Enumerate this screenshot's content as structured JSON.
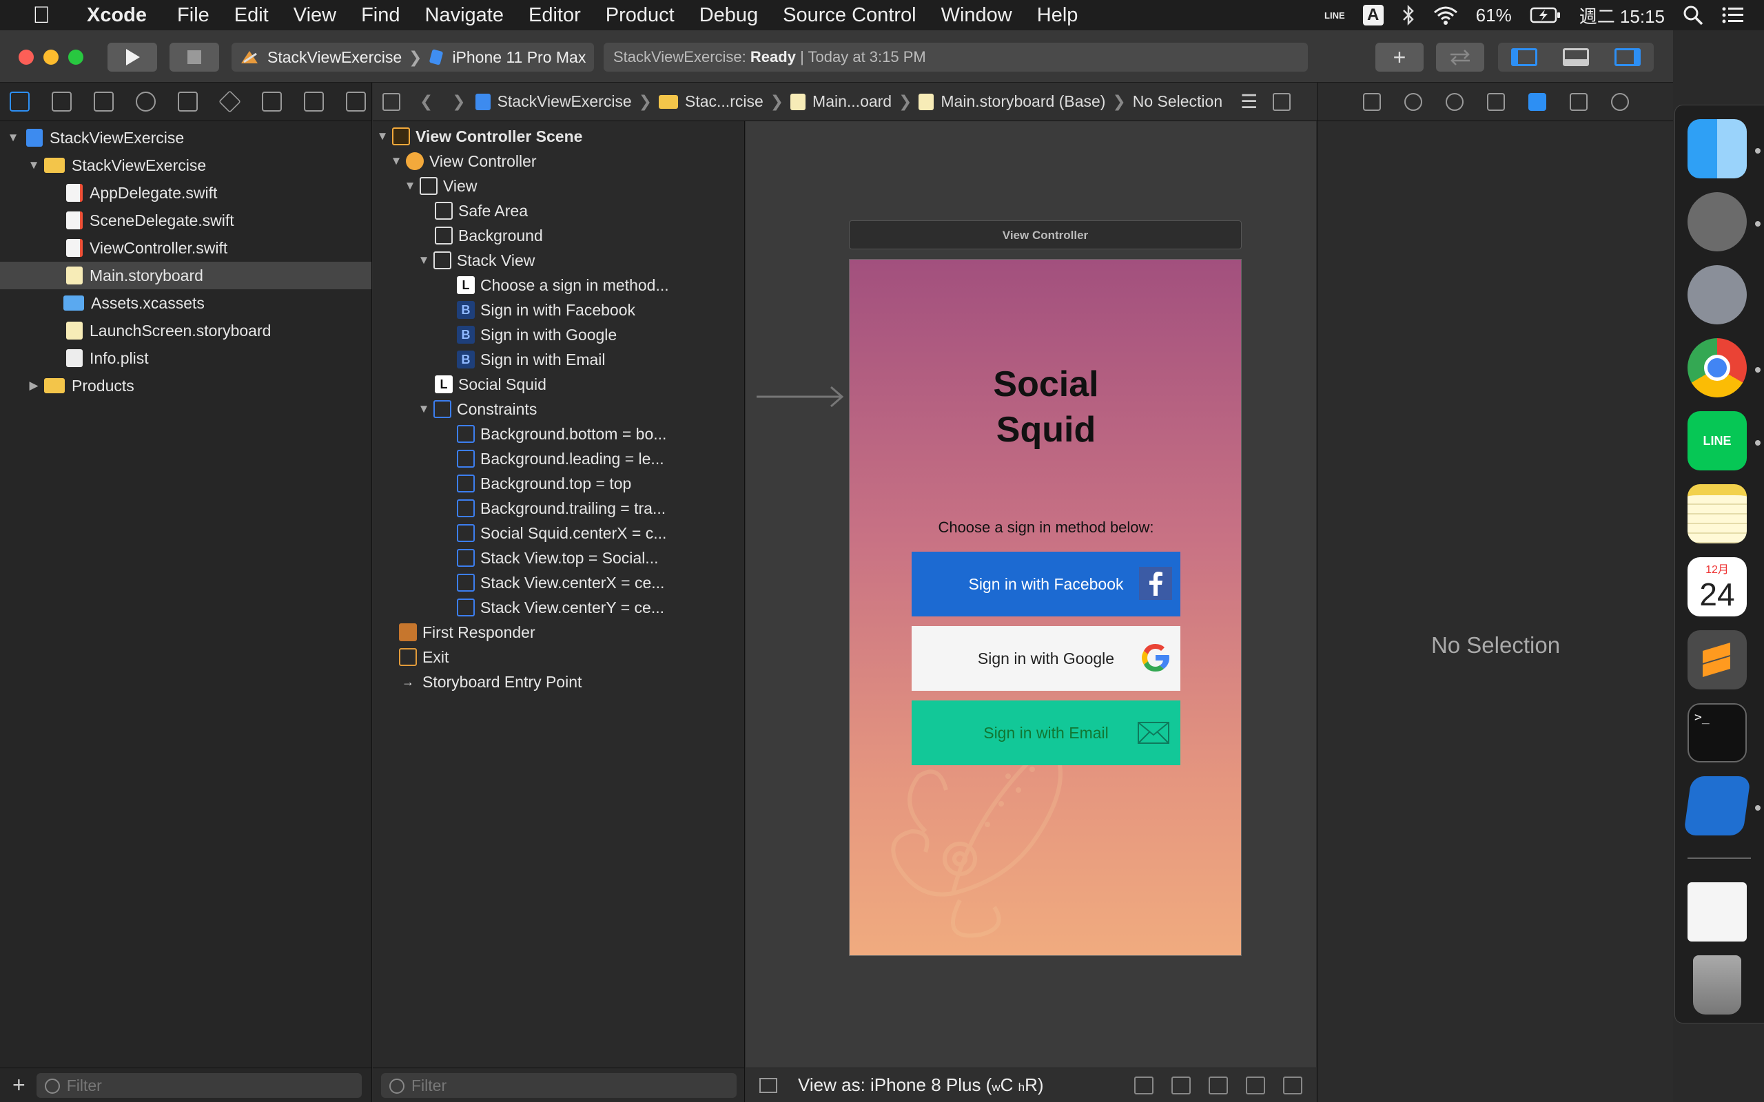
{
  "menubar": {
    "app_name": "Xcode",
    "items": [
      "File",
      "Edit",
      "View",
      "Find",
      "Navigate",
      "Editor",
      "Product",
      "Debug",
      "Source Control",
      "Window",
      "Help"
    ],
    "input_source": "A",
    "battery": "61%",
    "clock": "週二 15:15",
    "line_tag": "LINE"
  },
  "toolbar": {
    "scheme": "StackViewExercise",
    "device": "iPhone 11 Pro Max",
    "status_project": "StackViewExercise:",
    "status_state": "Ready",
    "status_time": "Today at 3:15 PM",
    "add_label": "+"
  },
  "navigator": {
    "items": [
      {
        "label": "StackViewExercise"
      },
      {
        "label": "StackViewExercise"
      },
      {
        "label": "AppDelegate.swift"
      },
      {
        "label": "SceneDelegate.swift"
      },
      {
        "label": "ViewController.swift"
      },
      {
        "label": "Main.storyboard"
      },
      {
        "label": "Assets.xcassets"
      },
      {
        "label": "LaunchScreen.storyboard"
      },
      {
        "label": "Info.plist"
      },
      {
        "label": "Products"
      }
    ],
    "filter_placeholder": "Filter"
  },
  "jumpbar": {
    "crumbs": [
      "StackViewExercise",
      "Stac...rcise",
      "Main...oard",
      "Main.storyboard (Base)",
      "No Selection"
    ]
  },
  "outline": {
    "rows": [
      {
        "label": "View Controller Scene",
        "badge": ""
      },
      {
        "label": "View Controller",
        "badge": ""
      },
      {
        "label": "View",
        "badge": ""
      },
      {
        "label": "Safe Area",
        "badge": ""
      },
      {
        "label": "Background",
        "badge": ""
      },
      {
        "label": "Stack View",
        "badge": ""
      },
      {
        "label": "Choose a sign in method...",
        "badge": "L"
      },
      {
        "label": "Sign in with Facebook",
        "badge": "B"
      },
      {
        "label": "Sign in with Google",
        "badge": "B"
      },
      {
        "label": "Sign in with Email",
        "badge": "B"
      },
      {
        "label": "Social  Squid",
        "badge": "L"
      },
      {
        "label": "Constraints",
        "badge": ""
      },
      {
        "label": "Background.bottom = bo...",
        "badge": ""
      },
      {
        "label": "Background.leading = le...",
        "badge": ""
      },
      {
        "label": "Background.top = top",
        "badge": ""
      },
      {
        "label": "Background.trailing = tra...",
        "badge": ""
      },
      {
        "label": "Social  Squid.centerX = c...",
        "badge": ""
      },
      {
        "label": "Stack View.top = Social...",
        "badge": ""
      },
      {
        "label": "Stack View.centerX = ce...",
        "badge": ""
      },
      {
        "label": "Stack View.centerY = ce...",
        "badge": ""
      },
      {
        "label": "First Responder",
        "badge": ""
      },
      {
        "label": "Exit",
        "badge": ""
      },
      {
        "label": "Storyboard Entry Point",
        "badge": ""
      }
    ],
    "filter_placeholder": "Filter"
  },
  "canvas": {
    "scene_title": "View Controller",
    "app_title_line1": "Social",
    "app_title_line2": "Squid",
    "prompt": "Choose a sign in method below:",
    "facebook_label": "Sign in with Facebook",
    "google_label": "Sign in with Google",
    "email_label": "Sign in with Email",
    "view_as_prefix": "View as: iPhone 8 Plus (",
    "size_w": "w",
    "size_C": "C",
    "size_h": "h",
    "size_R": "R",
    "view_as_suffix": ")"
  },
  "inspector": {
    "empty_text": "No Selection"
  },
  "dock": {
    "calendar_month": "12月",
    "calendar_day": "24",
    "line_label": "LINE"
  },
  "colors": {
    "accent": "#2d8ff4",
    "facebook": "#1c6ad2",
    "email": "#12c898",
    "gradient_top": "#a2507e",
    "gradient_bottom": "#f0ab7f"
  }
}
